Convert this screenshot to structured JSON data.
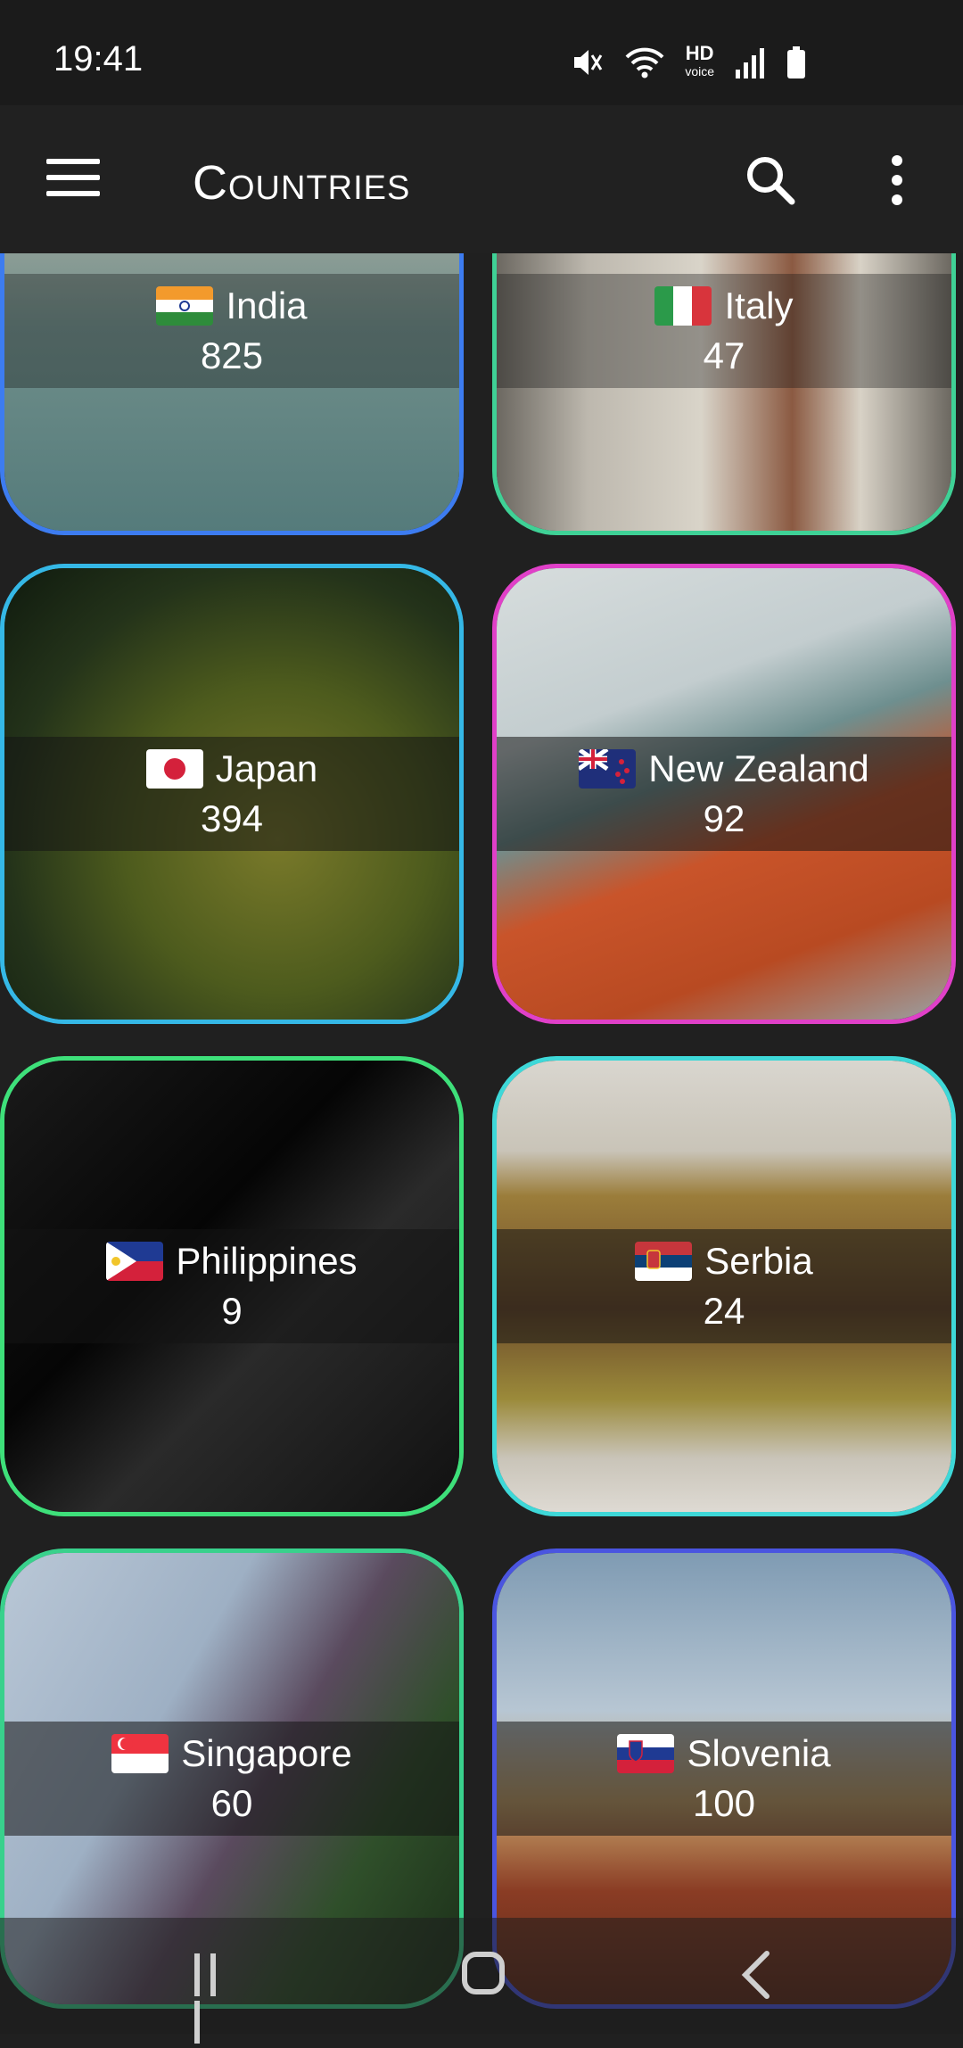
{
  "status_bar": {
    "time": "19:41",
    "icons": [
      "mute-icon",
      "wifi-icon",
      "hd-voice-icon",
      "signal-icon",
      "battery-icon"
    ],
    "hd_label": "HD",
    "voice_label": "voice"
  },
  "app_bar": {
    "title": "Countries",
    "icons": [
      "menu-icon",
      "search-icon",
      "more-vert-icon"
    ]
  },
  "countries": [
    {
      "name": "India",
      "count": "825",
      "border": "#3d7cf0",
      "flag": "india"
    },
    {
      "name": "Italy",
      "count": "47",
      "border": "#3fd196",
      "flag": "italy"
    },
    {
      "name": "Japan",
      "count": "394",
      "border": "#35b8e6",
      "flag": "japan"
    },
    {
      "name": "New Zealand",
      "count": "92",
      "border": "#e040c8",
      "flag": "new-zealand"
    },
    {
      "name": "Philippines",
      "count": "9",
      "border": "#3ee07a",
      "flag": "philippines"
    },
    {
      "name": "Serbia",
      "count": "24",
      "border": "#3ed8d8",
      "flag": "serbia"
    },
    {
      "name": "Singapore",
      "count": "60",
      "border": "#39d18c",
      "flag": "singapore"
    },
    {
      "name": "Slovenia",
      "count": "100",
      "border": "#4a55e0",
      "flag": "slovenia"
    }
  ],
  "nav_bar": {
    "icons": [
      "recents-icon",
      "home-icon",
      "back-icon"
    ]
  }
}
